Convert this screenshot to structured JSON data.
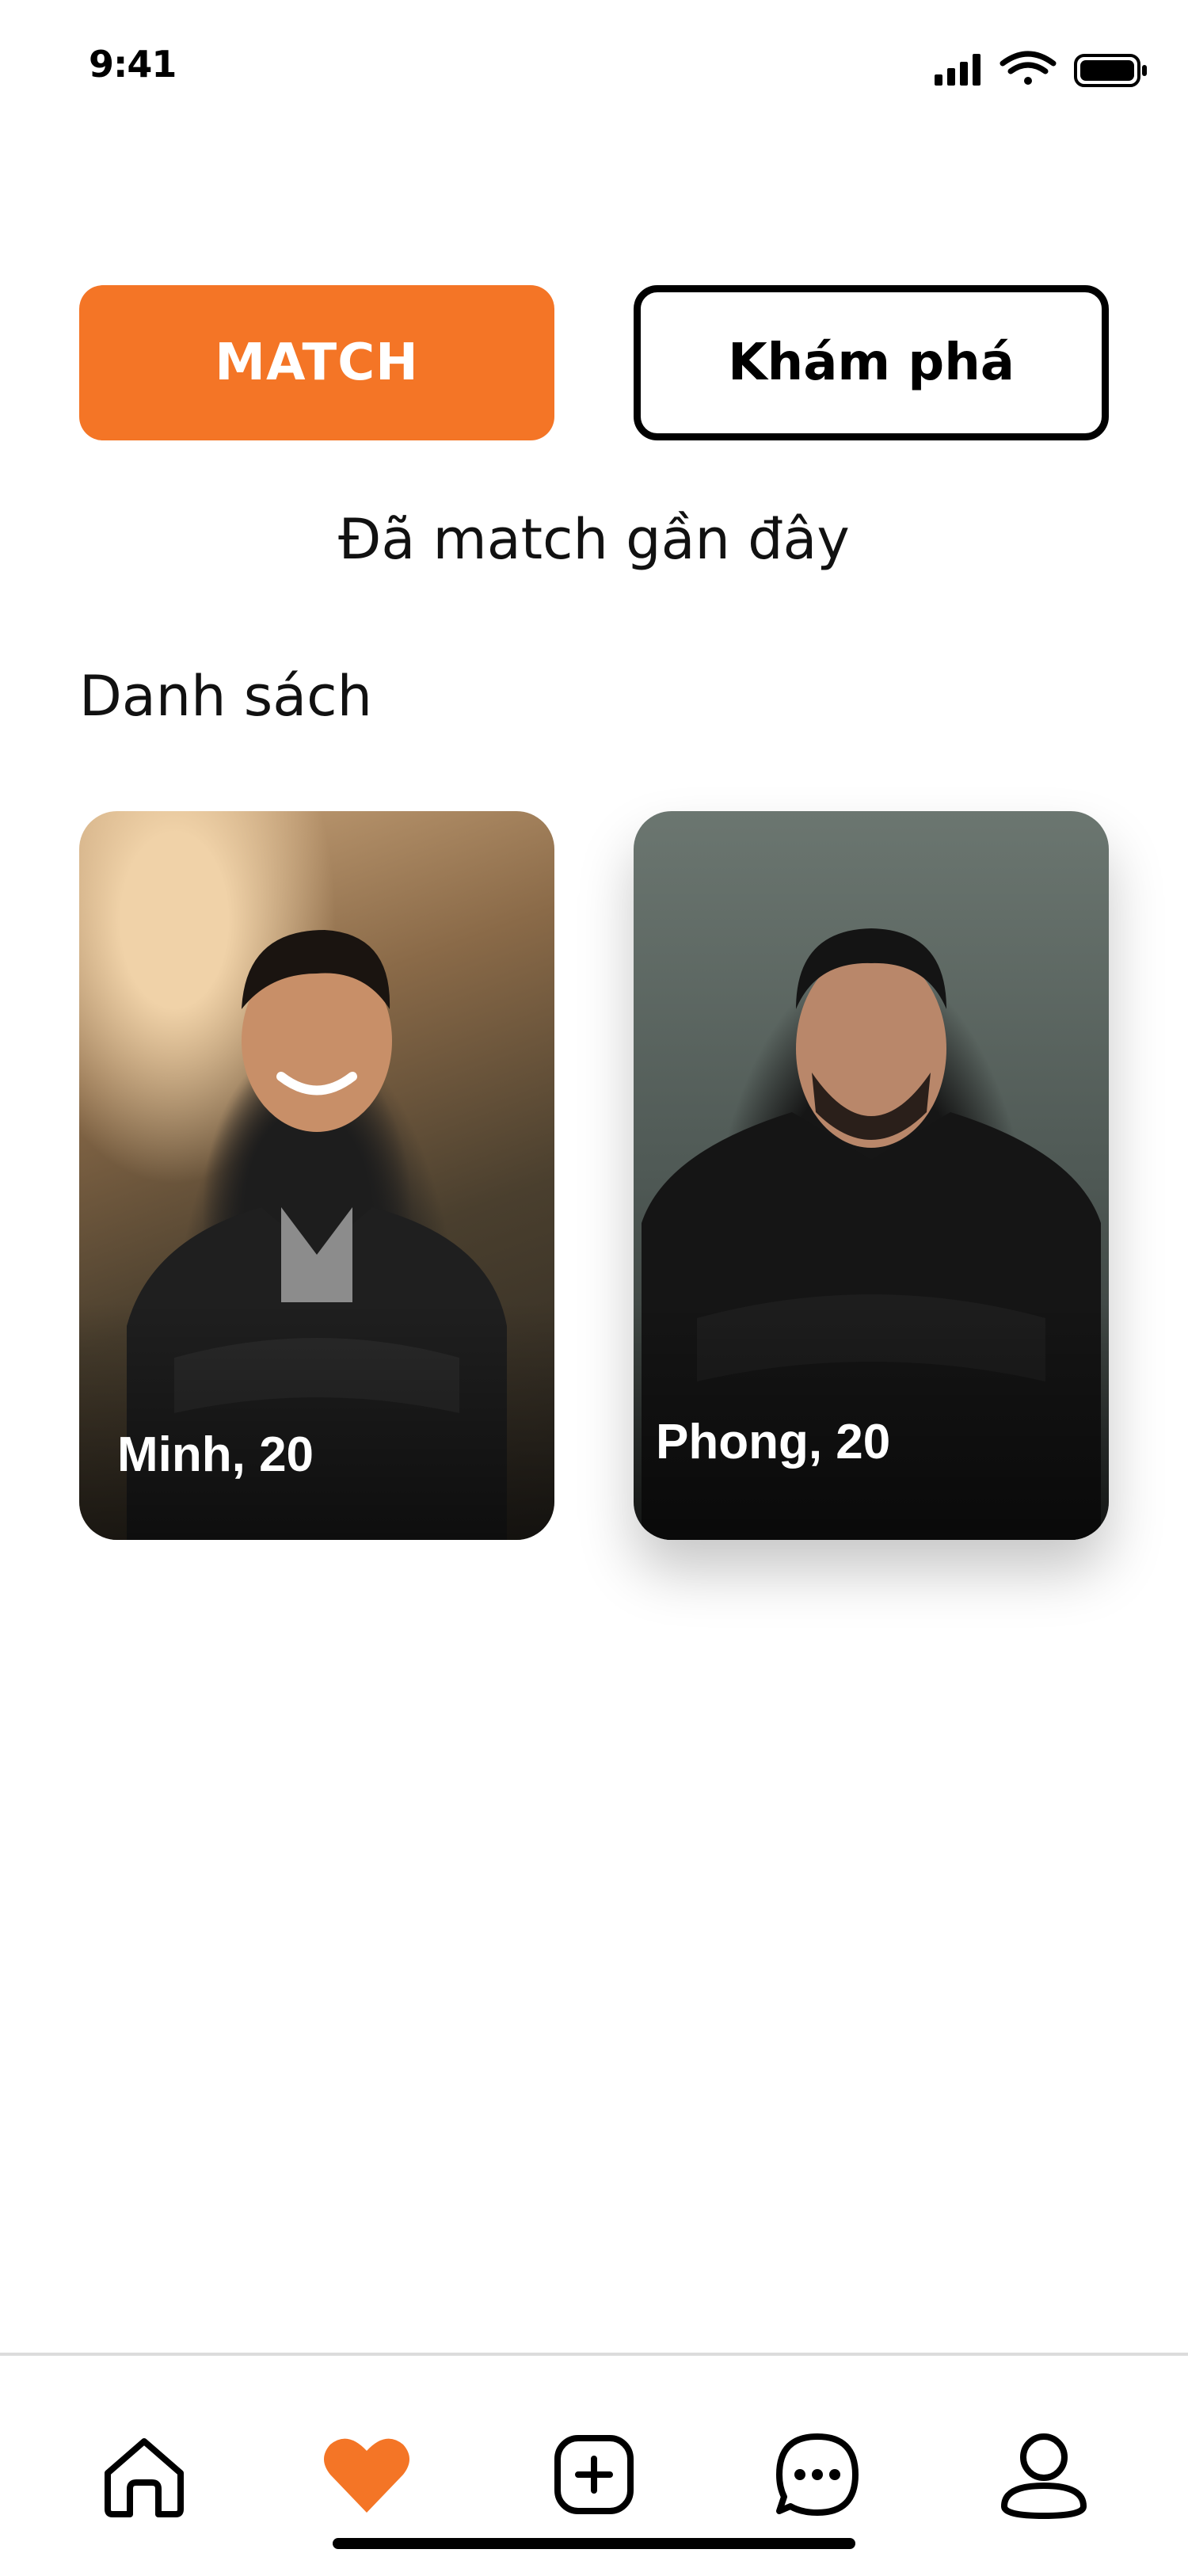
{
  "status_bar": {
    "time": "9:41"
  },
  "tabs": {
    "match_label": "MATCH",
    "explore_label": "Khám phá"
  },
  "section": {
    "title": "Đã match gần đây",
    "list_label": "Danh sách"
  },
  "matches": [
    {
      "name": "Minh, 20"
    },
    {
      "name": "Phong, 20"
    }
  ],
  "bottom_nav": {
    "items": [
      "home-icon",
      "heart-icon",
      "add-post-icon",
      "chat-icon",
      "profile-icon"
    ],
    "active": "heart-icon"
  },
  "colors": {
    "accent": "#F47526",
    "text": "#111111",
    "background": "#FFFFFF"
  }
}
